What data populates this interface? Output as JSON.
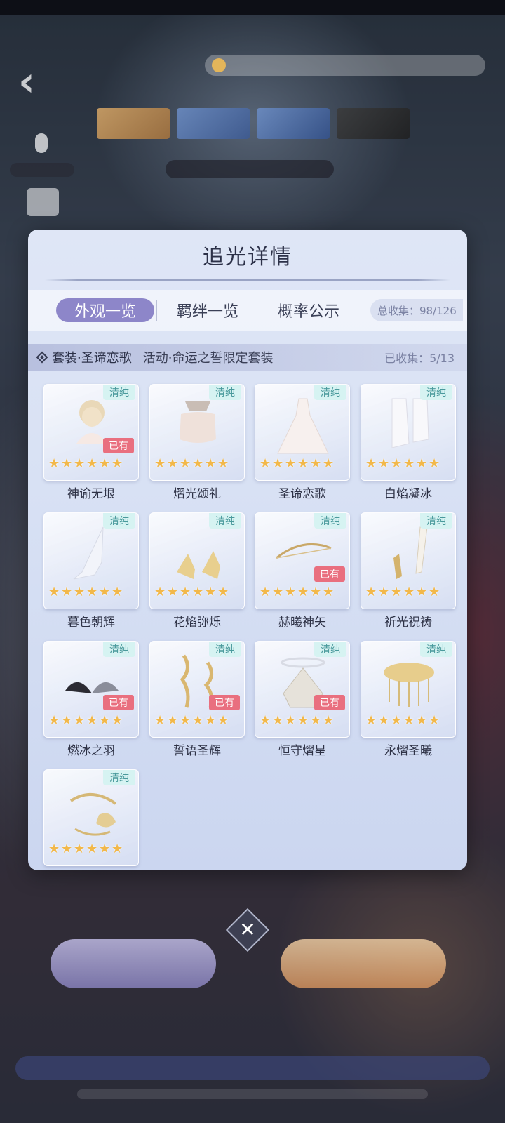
{
  "modal": {
    "title": "追光详情",
    "tabs": [
      "外观一览",
      "羁绊一览",
      "概率公示"
    ],
    "active_tab": 0,
    "total_collect": "总收集：98/126"
  },
  "set_bar": {
    "name": "套装·圣谛恋歌",
    "source": "活动·命运之誓限定套装",
    "collected": "已收集：5/13"
  },
  "owned_label": "已有",
  "items": [
    {
      "name": "神谕无垠",
      "tag": "清纯",
      "owned": true
    },
    {
      "name": "熠光颂礼",
      "tag": "清纯",
      "owned": false
    },
    {
      "name": "圣谛恋歌",
      "tag": "清纯",
      "owned": false
    },
    {
      "name": "白焰凝冰",
      "tag": "清纯",
      "owned": false
    },
    {
      "name": "暮色朝辉",
      "tag": "清纯",
      "owned": false
    },
    {
      "name": "花焰弥烁",
      "tag": "清纯",
      "owned": false
    },
    {
      "name": "赫曦神矢",
      "tag": "清纯",
      "owned": true
    },
    {
      "name": "祈光祝祷",
      "tag": "清纯",
      "owned": false
    },
    {
      "name": "燃冰之羽",
      "tag": "清纯",
      "owned": true
    },
    {
      "name": "誓语圣辉",
      "tag": "清纯",
      "owned": true
    },
    {
      "name": "恒守熠星",
      "tag": "清纯",
      "owned": true
    },
    {
      "name": "永熠圣曦",
      "tag": "清纯",
      "owned": false
    },
    {
      "name": "",
      "tag": "清纯",
      "owned": false
    }
  ],
  "item_rarity_stars": 6,
  "icons": {
    "back": "back-arrow-icon",
    "close": "close-icon",
    "set": "diamond-icon",
    "star": "star-icon"
  },
  "colors": {
    "active_tab": "#8d86c9",
    "owned_badge": "#e96f7f",
    "tag_bg": "#d6f3f2",
    "star": "#f2b84a"
  }
}
